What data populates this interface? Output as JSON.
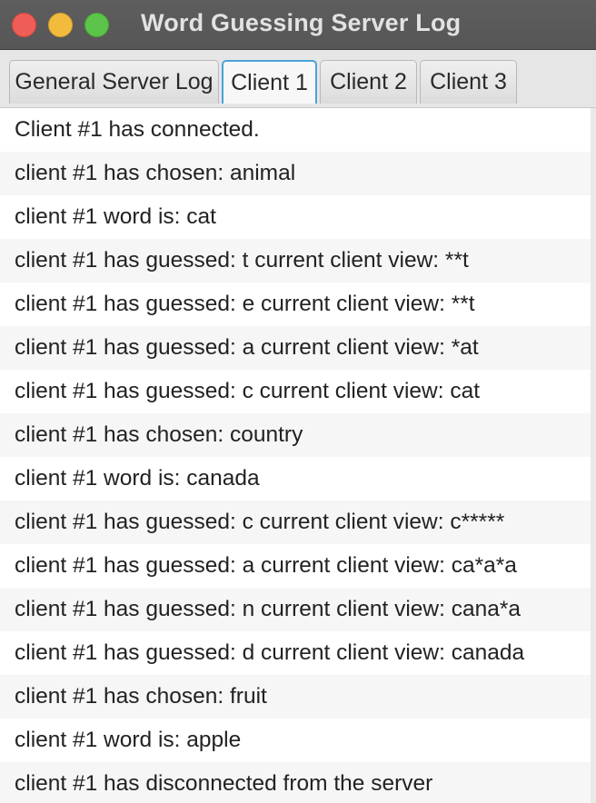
{
  "window": {
    "title": "Word Guessing Server Log"
  },
  "tabs": [
    {
      "label": "General Server Log",
      "selected": false
    },
    {
      "label": "Client 1",
      "selected": true
    },
    {
      "label": "Client 2",
      "selected": false
    },
    {
      "label": "Client 3",
      "selected": false
    }
  ],
  "log": {
    "entries": [
      "Client #1 has connected.",
      "client #1 has chosen: animal",
      "client #1 word is: cat",
      "client #1 has guessed: t current client view: **t",
      "client #1 has guessed: e current client view: **t",
      "client #1 has guessed: a current client view: *at",
      "client #1 has guessed: c current client view: cat",
      "client #1 has chosen: country",
      "client #1 word is: canada",
      "client #1 has guessed: c current client view: c*****",
      "client #1 has guessed: a current client view: ca*a*a",
      "client #1 has guessed: n current client view: cana*a",
      "client #1 has guessed: d current client view: canada",
      "client #1 has chosen: fruit",
      "client #1 word is: apple",
      "client #1 has disconnected from the server"
    ]
  },
  "colors": {
    "titlebar": "#5a5a5a",
    "close": "#ee5e57",
    "minimize": "#f2bb3d",
    "maximize": "#5cc44a",
    "selected_tab_border": "#4ba3d8"
  }
}
